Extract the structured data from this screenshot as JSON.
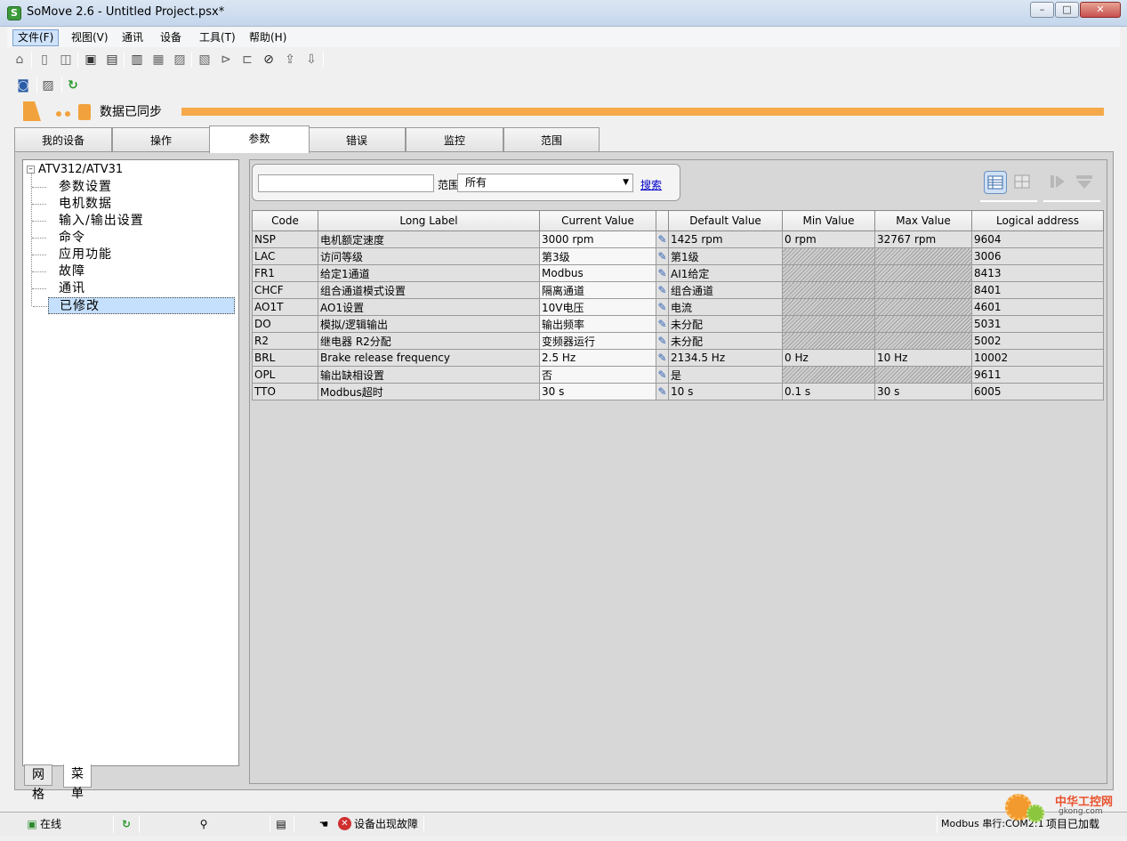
{
  "window": {
    "title": "SoMove 2.6 - Untitled Project.psx*",
    "controls": [
      "–",
      "□",
      "✕"
    ]
  },
  "menu": [
    "文件(F)",
    "视图(V)",
    "通讯",
    "设备",
    "工具(T)",
    "帮助(H)"
  ],
  "sync": {
    "status": "数据已同步"
  },
  "tabs": [
    "我的设备",
    "操作",
    "参数",
    "错误",
    "监控",
    "范围"
  ],
  "tree": {
    "root": "ATV312/ATV31",
    "items": [
      "参数设置",
      "电机数据",
      "输入/输出设置",
      "命令",
      "应用功能",
      "故障",
      "通讯",
      "已修改"
    ],
    "selected_index": 7
  },
  "bottom_tabs": [
    "网格",
    "菜单"
  ],
  "filter": {
    "search_value": "",
    "scope_label": "范围:",
    "scope_value": "所有",
    "search_link": "搜索"
  },
  "table": {
    "headers": [
      "Code",
      "Long Label",
      "Current Value",
      "",
      "Default Value",
      "Min Value",
      "Max Value",
      "Logical address"
    ],
    "rows": [
      {
        "code": "NSP",
        "label": "电机额定速度",
        "current": "3000 rpm",
        "default": "1425 rpm",
        "min": "0 rpm",
        "max": "32767 rpm",
        "address": "9604",
        "hatched": false
      },
      {
        "code": "LAC",
        "label": "访问等级",
        "current": "第3级",
        "default": "第1级",
        "min": "",
        "max": "",
        "address": "3006",
        "hatched": true
      },
      {
        "code": "FR1",
        "label": "给定1通道",
        "current": "Modbus",
        "default": "AI1给定",
        "min": "",
        "max": "",
        "address": "8413",
        "hatched": true
      },
      {
        "code": "CHCF",
        "label": "组合通道模式设置",
        "current": "隔离通道",
        "default": "组合通道",
        "min": "",
        "max": "",
        "address": "8401",
        "hatched": true
      },
      {
        "code": "AO1T",
        "label": "AO1设置",
        "current": "10V电压",
        "default": "电流",
        "min": "",
        "max": "",
        "address": "4601",
        "hatched": true
      },
      {
        "code": "DO",
        "label": "模拟/逻辑输出",
        "current": "输出频率",
        "default": "未分配",
        "min": "",
        "max": "",
        "address": "5031",
        "hatched": true
      },
      {
        "code": "R2",
        "label": "继电器 R2分配",
        "current": "变频器运行",
        "default": "未分配",
        "min": "",
        "max": "",
        "address": "5002",
        "hatched": true
      },
      {
        "code": "BRL",
        "label": "Brake release frequency",
        "current": "2.5 Hz",
        "default": "2134.5 Hz",
        "min": "0 Hz",
        "max": "10 Hz",
        "address": "10002",
        "hatched": false
      },
      {
        "code": "OPL",
        "label": "输出缺相设置",
        "current": "否",
        "default": "是",
        "min": "",
        "max": "",
        "address": "9611",
        "hatched": true
      },
      {
        "code": "TTO",
        "label": "Modbus超时",
        "current": "30 s",
        "default": "10 s",
        "min": "0.1 s",
        "max": "30 s",
        "address": "6005",
        "hatched": false
      }
    ]
  },
  "status": {
    "online": "在线",
    "fault": "设备出现故障",
    "connection": "Modbus 串行:COM2:1",
    "project": "项目已加载"
  },
  "watermark": {
    "text": "中华工控网",
    "url": "gkong.com"
  },
  "colors": {
    "accent_orange": "#f5a94a",
    "selection_blue": "#c5e0fc",
    "link": "#0000cc"
  }
}
